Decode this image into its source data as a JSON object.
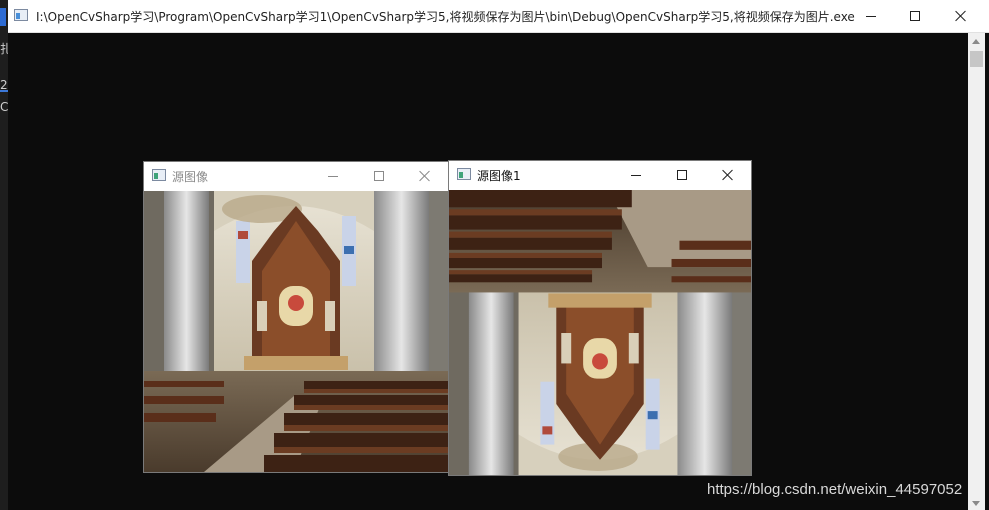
{
  "background_app": {
    "fragment_top": "扎",
    "fragment_mid": "2",
    "fragment_low": "C"
  },
  "main_window": {
    "title": "I:\\OpenCvSharp学习\\Program\\OpenCvSharp学习1\\OpenCvSharp学习5,将视频保存为图片\\bin\\Debug\\OpenCvSharp学习5,将视频保存为图片.exe",
    "icon": "console-app-icon"
  },
  "windows": {
    "source": {
      "title": "源图像",
      "state": "inactive"
    },
    "source_flipped": {
      "title": "源图像1",
      "state": "active"
    }
  },
  "watermark": "https://blog.csdn.net/weixin_44597052",
  "colors": {
    "console_bg": "#0c0c0c",
    "titlebar_bg": "#ffffff",
    "accent": "#3c78d8"
  }
}
